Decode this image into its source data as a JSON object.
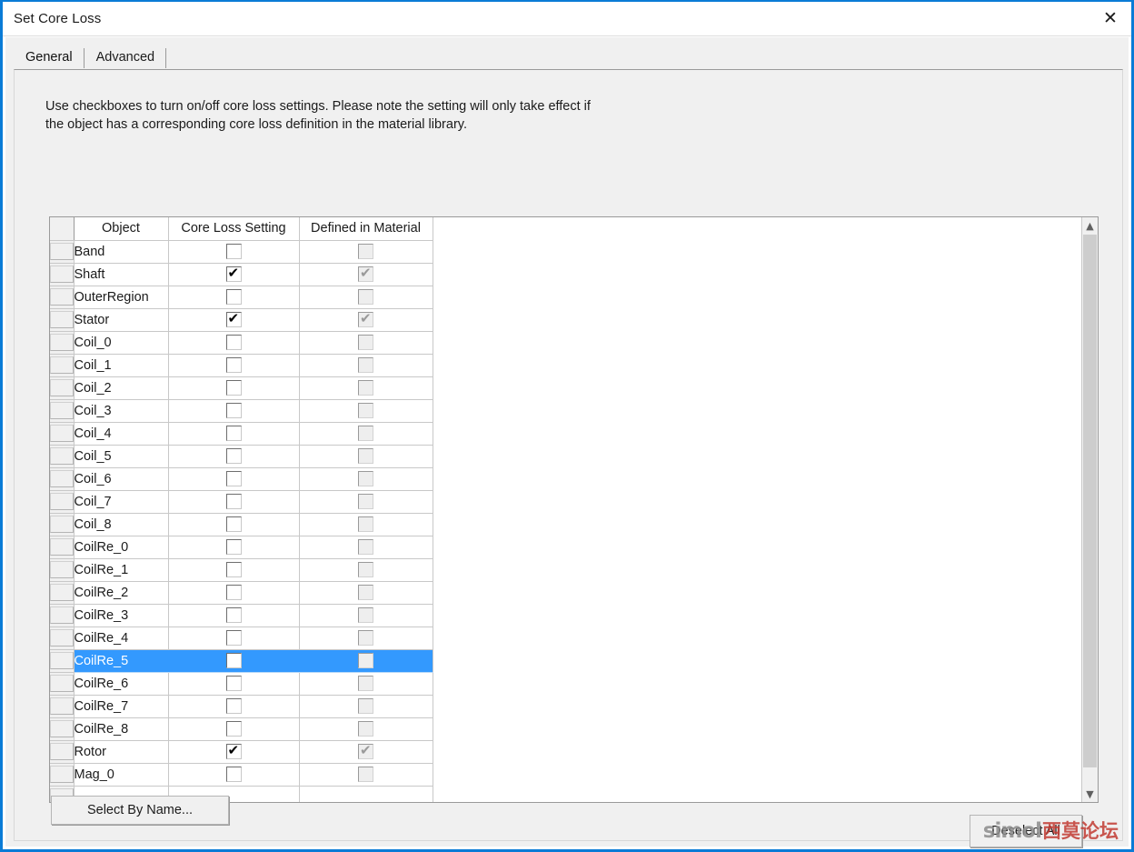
{
  "window": {
    "title": "Set Core Loss",
    "close_icon": "close-icon"
  },
  "tabs": [
    {
      "label": "General",
      "active": true
    },
    {
      "label": "Advanced",
      "active": false
    }
  ],
  "description": "Use checkboxes to turn on/off core loss settings.  Please note the setting will only take effect if the object has a corresponding core loss definition in the material library.",
  "grid": {
    "columns": [
      "",
      "Object",
      "Core Loss Setting",
      "Defined in Material"
    ],
    "rows": [
      {
        "object": "Band",
        "core_loss": false,
        "defined": false,
        "selected": false
      },
      {
        "object": "Shaft",
        "core_loss": true,
        "defined": true,
        "selected": false
      },
      {
        "object": "OuterRegion",
        "core_loss": false,
        "defined": false,
        "selected": false
      },
      {
        "object": "Stator",
        "core_loss": true,
        "defined": true,
        "selected": false
      },
      {
        "object": "Coil_0",
        "core_loss": false,
        "defined": false,
        "selected": false
      },
      {
        "object": "Coil_1",
        "core_loss": false,
        "defined": false,
        "selected": false
      },
      {
        "object": "Coil_2",
        "core_loss": false,
        "defined": false,
        "selected": false
      },
      {
        "object": "Coil_3",
        "core_loss": false,
        "defined": false,
        "selected": false
      },
      {
        "object": "Coil_4",
        "core_loss": false,
        "defined": false,
        "selected": false
      },
      {
        "object": "Coil_5",
        "core_loss": false,
        "defined": false,
        "selected": false
      },
      {
        "object": "Coil_6",
        "core_loss": false,
        "defined": false,
        "selected": false
      },
      {
        "object": "Coil_7",
        "core_loss": false,
        "defined": false,
        "selected": false
      },
      {
        "object": "Coil_8",
        "core_loss": false,
        "defined": false,
        "selected": false
      },
      {
        "object": "CoilRe_0",
        "core_loss": false,
        "defined": false,
        "selected": false
      },
      {
        "object": "CoilRe_1",
        "core_loss": false,
        "defined": false,
        "selected": false
      },
      {
        "object": "CoilRe_2",
        "core_loss": false,
        "defined": false,
        "selected": false
      },
      {
        "object": "CoilRe_3",
        "core_loss": false,
        "defined": false,
        "selected": false
      },
      {
        "object": "CoilRe_4",
        "core_loss": false,
        "defined": false,
        "selected": false
      },
      {
        "object": "CoilRe_5",
        "core_loss": false,
        "defined": false,
        "selected": true
      },
      {
        "object": "CoilRe_6",
        "core_loss": false,
        "defined": false,
        "selected": false
      },
      {
        "object": "CoilRe_7",
        "core_loss": false,
        "defined": false,
        "selected": false
      },
      {
        "object": "CoilRe_8",
        "core_loss": false,
        "defined": false,
        "selected": false
      },
      {
        "object": "Rotor",
        "core_loss": true,
        "defined": true,
        "selected": false
      },
      {
        "object": "Mag_0",
        "core_loss": false,
        "defined": false,
        "selected": false
      },
      {
        "object": "",
        "core_loss": null,
        "defined": null,
        "selected": false
      }
    ]
  },
  "scrollbar": {
    "up_icon": "chevron-up-icon",
    "down_icon": "chevron-down-icon"
  },
  "buttons": {
    "select_by_name": "Select By Name...",
    "deselect_all": "Deselect All"
  },
  "watermark": {
    "latin": "simol",
    "chinese": "西莫论坛"
  },
  "colors": {
    "accent": "#0a7bd6",
    "selection": "#3399fe",
    "dialog_bg": "#f0f0f0",
    "grid_bg": "#ffffff",
    "watermark_red": "#c23b32"
  }
}
